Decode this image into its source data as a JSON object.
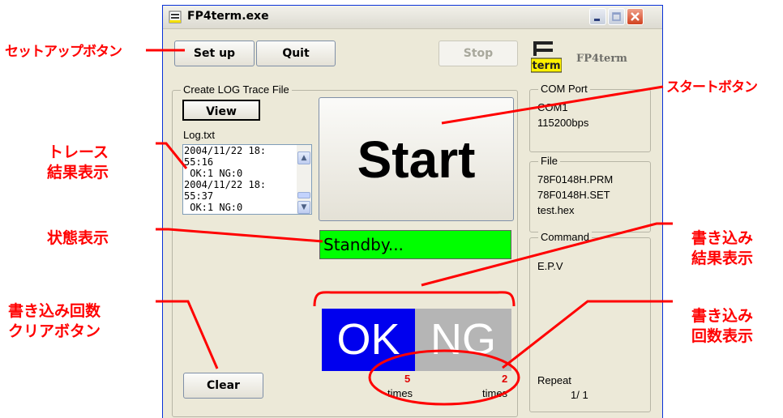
{
  "window": {
    "title": "FP4term.exe",
    "icon": "app-terminal-icon",
    "controls": [
      "minimize-icon",
      "maximize-icon",
      "close-icon"
    ]
  },
  "toolbar": {
    "setup_label": "Set up",
    "quit_label": "Quit",
    "stop_label": "Stop",
    "logo_icon_text": "term",
    "logo_text": "FP4term"
  },
  "trace": {
    "group_label": "Create LOG Trace File",
    "view_label": "View",
    "file_name": "Log.txt",
    "log_content": "2004/11/22 18:\n55:16\n OK:1 NG:0\n2004/11/22 18:\n55:37\n OK:1 NG:0"
  },
  "start": {
    "label": "Start",
    "status": "Standby...",
    "status_color": "#00ff00"
  },
  "results": {
    "ok_label": "OK",
    "ng_label": "NG",
    "ok_color": "#0000ee",
    "ng_color": "#b5b5b5",
    "ok_count": "5",
    "ng_count": "2",
    "unit": "times",
    "count_color": "#e00000"
  },
  "clear_label": "Clear",
  "com_port": {
    "label": "COM Port",
    "port": "COM1",
    "baud": "115200bps"
  },
  "file": {
    "label": "File",
    "lines": [
      "78F0148H.PRM",
      "78F0148H.SET",
      "test.hex"
    ]
  },
  "command": {
    "label": "Command",
    "value": "E.P.V",
    "repeat_label": "Repeat",
    "repeat_value": "1/ 1"
  },
  "annotations": {
    "color": "#ff0000",
    "setup_button": "セットアップボタン",
    "start_button": "スタートボタン",
    "trace_result": "トレース\n結果表示",
    "status_display": "状態表示",
    "write_result": "書き込み\n結果表示",
    "clear_button": "書き込み回数\nクリアボタン",
    "write_count": "書き込み\n回数表示"
  }
}
